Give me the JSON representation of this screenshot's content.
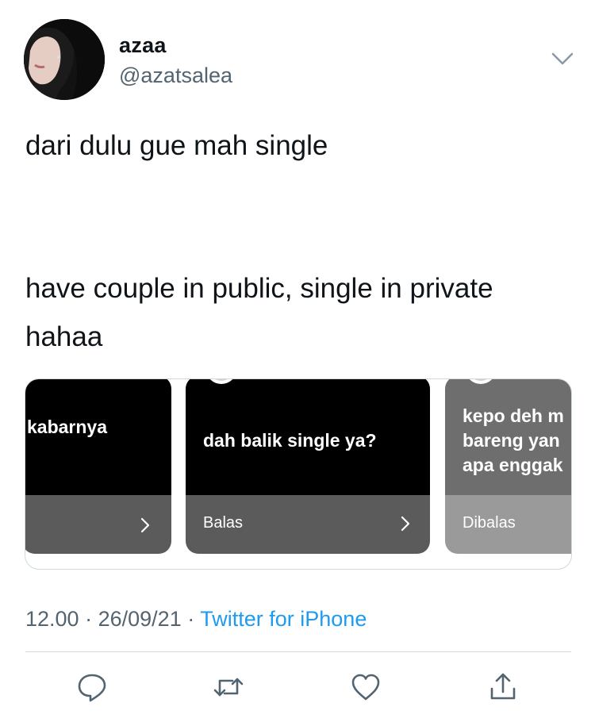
{
  "tweet": {
    "display_name": "azaa",
    "handle": "@azatsalea",
    "lines": [
      "dari dulu gue mah single",
      "have couple in public, single in private",
      "hahaa"
    ]
  },
  "carousel": {
    "cards": [
      {
        "text": "kabarnya",
        "label": ""
      },
      {
        "text": "dah balik single ya?",
        "label": "Balas"
      },
      {
        "lines": [
          "kepo deh m",
          "bareng yan",
          "apa enggak"
        ],
        "label": "Dibalas"
      }
    ]
  },
  "meta": {
    "time": "12.00",
    "separator": "·",
    "date": "26/09/21",
    "source": "Twitter for iPhone"
  },
  "actions": [
    "reply-icon",
    "retweet-icon",
    "like-icon",
    "share-icon"
  ],
  "colors": {
    "link": "#1d9bf0",
    "secondary": "#536471",
    "divider": "#cfd9de"
  }
}
